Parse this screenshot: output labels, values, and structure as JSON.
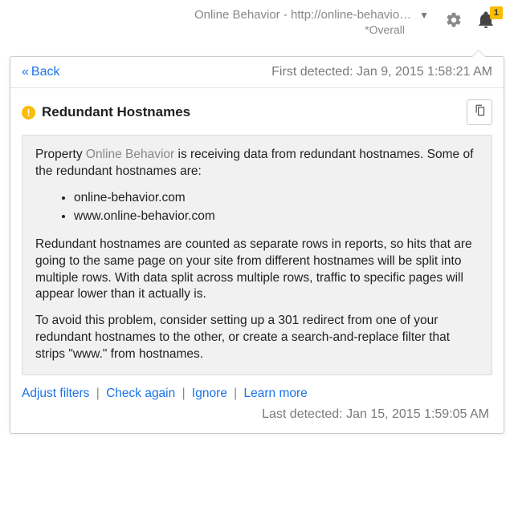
{
  "topbar": {
    "property_line1": "Online Behavior - http://online-behavio…",
    "property_sub": "*Overall",
    "badge_count": "1"
  },
  "popover": {
    "back_label": "Back",
    "first_detected_label": "First detected:",
    "first_detected_value": "Jan 9, 2015 1:58:21 AM",
    "title": "Redundant Hostnames",
    "message": {
      "intro_prefix": "Property ",
      "property_name": "Online Behavior",
      "intro_suffix": " is receiving data from redundant hostnames. Some of the redundant hostnames are:",
      "hostnames": [
        "online-behavior.com",
        "www.online-behavior.com"
      ],
      "para2": "Redundant hostnames are counted as separate rows in reports, so hits that are going to the same page on your site from different hostnames will be split into multiple rows. With data split across multiple rows, traffic to specific pages will appear lower than it actually is.",
      "para3": "To avoid this problem, consider setting up a 301 redirect from one of your redundant hostnames to the other, or create a search-and-replace filter that strips \"www.\" from hostnames."
    },
    "actions": {
      "adjust_filters": "Adjust filters",
      "check_again": "Check again",
      "ignore": "Ignore",
      "learn_more": "Learn more"
    },
    "last_detected_label": "Last detected:",
    "last_detected_value": "Jan 15, 2015 1:59:05 AM"
  }
}
